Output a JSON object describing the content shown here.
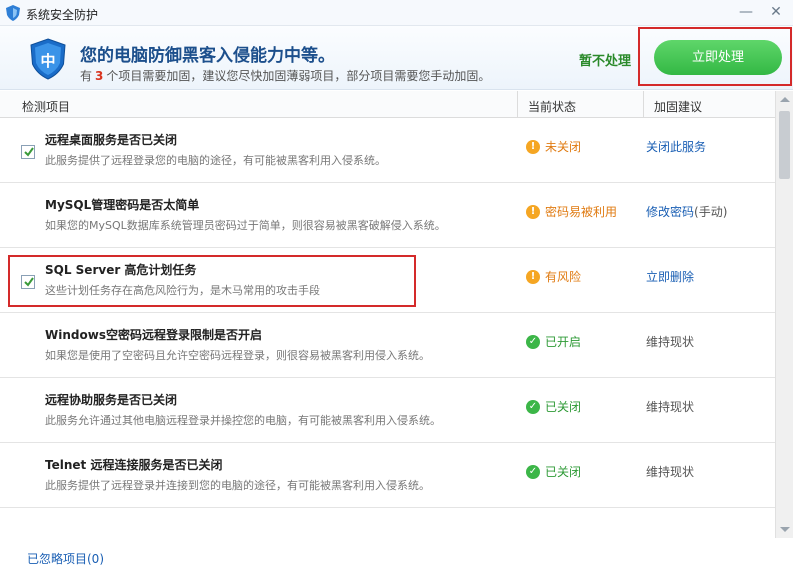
{
  "window": {
    "title": "系统安全防护",
    "minimize_glyph": "—",
    "close_glyph": "✕"
  },
  "header": {
    "headline": "您的电脑防御黑客入侵能力中等。",
    "shield_char": "中",
    "sub_prefix": "有",
    "sub_count": "3",
    "sub_suffix": "个项目需要加固，建议您尽快加固薄弱项目，部分项目需要您手动加固。",
    "ignore_label": "暂不处理",
    "fix_label": "立即处理"
  },
  "columns": {
    "item": "检测项目",
    "status": "当前状态",
    "advice": "加固建议"
  },
  "rows": [
    {
      "name": "远程桌面服务是否已关闭",
      "desc": "此服务提供了远程登录您的电脑的途径，有可能被黑客利用入侵系统。",
      "checked": true,
      "status_type": "warn",
      "status_icon": "!",
      "status": "未关闭",
      "action": "关闭此服务",
      "action_extra": "",
      "action_link": true
    },
    {
      "name": "MySQL管理密码是否太简单",
      "desc": "如果您的MySQL数据库系统管理员密码过于简单，则很容易被黑客破解侵入系统。",
      "checked": false,
      "status_type": "warn",
      "status_icon": "!",
      "status": "密码易被利用",
      "action": "修改密码",
      "action_extra": "(手动)",
      "action_link": true
    },
    {
      "name": "SQL Server 高危计划任务",
      "desc": "这些计划任务存在高危风险行为，是木马常用的攻击手段",
      "checked": true,
      "status_type": "warn",
      "status_icon": "!",
      "status": "有风险",
      "action": "立即删除",
      "action_extra": "",
      "action_link": true
    },
    {
      "name": "Windows空密码远程登录限制是否开启",
      "desc": "如果您是使用了空密码且允许空密码远程登录，则很容易被黑客利用侵入系统。",
      "checked": false,
      "status_type": "ok",
      "status_icon": "✓",
      "status": "已开启",
      "action": "维持现状",
      "action_extra": "",
      "action_link": false
    },
    {
      "name": "远程协助服务是否已关闭",
      "desc": "此服务允许通过其他电脑远程登录并操控您的电脑，有可能被黑客利用入侵系统。",
      "checked": false,
      "status_type": "ok",
      "status_icon": "✓",
      "status": "已关闭",
      "action": "维持现状",
      "action_extra": "",
      "action_link": false
    },
    {
      "name": "Telnet 远程连接服务是否已关闭",
      "desc": "此服务提供了远程登录并连接到您的电脑的途径，有可能被黑客利用入侵系统。",
      "checked": false,
      "status_type": "ok",
      "status_icon": "✓",
      "status": "已关闭",
      "action": "维持现状",
      "action_extra": "",
      "action_link": false
    }
  ],
  "footer": {
    "ignored_label": "已忽略项目(0)"
  },
  "colors": {
    "accent": "#33b844",
    "link": "#1a5fb4",
    "warn": "#f5a623",
    "ok": "#3cb648",
    "highlight": "#d42a2a"
  }
}
